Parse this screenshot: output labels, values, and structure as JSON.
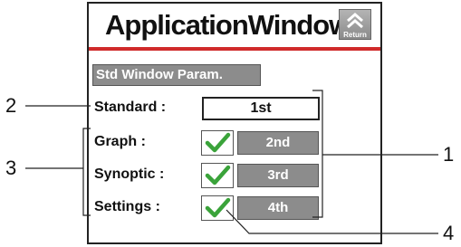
{
  "window": {
    "title": "ApplicationWindows",
    "return_label": "Return"
  },
  "section": {
    "header": "Std Window Param."
  },
  "standard": {
    "label": "Standard :",
    "value": "1st"
  },
  "rows": [
    {
      "label": "Graph :",
      "checked": true,
      "order": "2nd"
    },
    {
      "label": "Synoptic :",
      "checked": true,
      "order": "3rd"
    },
    {
      "label": "Settings :",
      "checked": true,
      "order": "4th"
    }
  ],
  "callouts": {
    "c1": "1",
    "c2": "2",
    "c3": "3",
    "c4": "4"
  },
  "colors": {
    "accent_red": "#d02a2a",
    "button_gray": "#8c8c8c",
    "check_green": "#3aa33a"
  },
  "icons": {
    "return": "return-chevron-icon",
    "check": "check-icon"
  }
}
